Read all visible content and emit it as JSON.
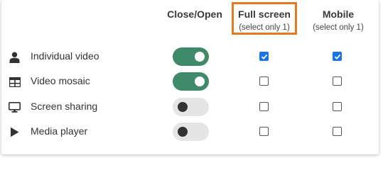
{
  "columns": {
    "close_open": {
      "title": "Close/Open"
    },
    "full_screen": {
      "title": "Full screen",
      "note": "(select only 1)"
    },
    "mobile": {
      "title": "Mobile",
      "note": "(select only 1)"
    }
  },
  "rows": [
    {
      "label": "Individual video",
      "icon": "person-icon",
      "toggle_on": true,
      "full_screen": true,
      "mobile": true
    },
    {
      "label": "Video mosaic",
      "icon": "grid-icon",
      "toggle_on": true,
      "full_screen": false,
      "mobile": false
    },
    {
      "label": "Screen sharing",
      "icon": "monitor-icon",
      "toggle_on": false,
      "full_screen": false,
      "mobile": false
    },
    {
      "label": "Media player",
      "icon": "play-icon",
      "toggle_on": false,
      "full_screen": false,
      "mobile": false
    }
  ],
  "colors": {
    "highlight_border": "#E87722",
    "toggle_on": "#3f8a6a",
    "toggle_off": "#e5e5e5",
    "checkbox_checked": "#1a73e8"
  }
}
